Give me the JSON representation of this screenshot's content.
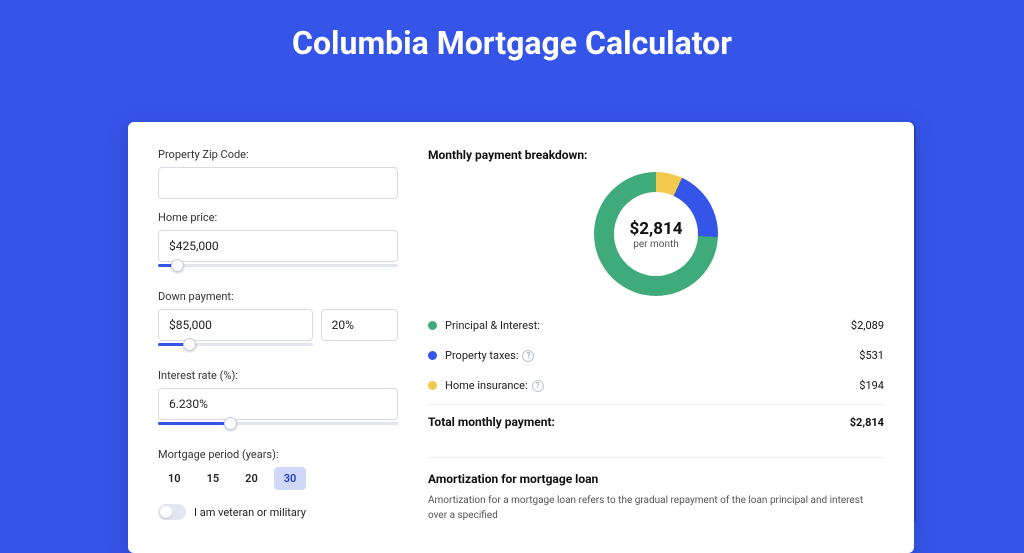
{
  "page": {
    "title": "Columbia Mortgage Calculator"
  },
  "form": {
    "zip_label": "Property Zip Code:",
    "zip_value": "",
    "home_price_label": "Home price:",
    "home_price_value": "$425,000",
    "home_price_slider_pct": 8,
    "down_payment_label": "Down payment:",
    "down_payment_value": "$85,000",
    "down_payment_pct": "20%",
    "down_payment_slider_pct": 20,
    "rate_label": "Interest rate (%):",
    "rate_value": "6.230%",
    "rate_slider_pct": 30,
    "period_label": "Mortgage period (years):",
    "periods": [
      "10",
      "15",
      "20",
      "30"
    ],
    "period_active_index": 3,
    "veteran_label": "I am veteran or military",
    "veteran_on": false
  },
  "breakdown": {
    "title": "Monthly payment breakdown:",
    "center_value": "$2,814",
    "center_sub": "per month",
    "items": [
      {
        "label": "Principal & Interest:",
        "amount": "$2,089",
        "value_num": 2089,
        "color": "#3faa7a",
        "has_info": false
      },
      {
        "label": "Property taxes:",
        "amount": "$531",
        "value_num": 531,
        "color": "#3554e8",
        "has_info": true
      },
      {
        "label": "Home insurance:",
        "amount": "$194",
        "value_num": 194,
        "color": "#f2c94c",
        "has_info": true
      }
    ],
    "total_label": "Total monthly payment:",
    "total_amount": "$2,814"
  },
  "amort": {
    "title": "Amortization for mortgage loan",
    "desc": "Amortization for a mortgage loan refers to the gradual repayment of the loan principal and interest over a specified"
  },
  "chart_data": {
    "type": "pie",
    "title": "Monthly payment breakdown",
    "categories": [
      "Principal & Interest",
      "Property taxes",
      "Home insurance"
    ],
    "values": [
      2089,
      531,
      194
    ],
    "colors": [
      "#3faa7a",
      "#3554e8",
      "#f2c94c"
    ],
    "center_label": "$2,814 per month",
    "total": 2814
  }
}
